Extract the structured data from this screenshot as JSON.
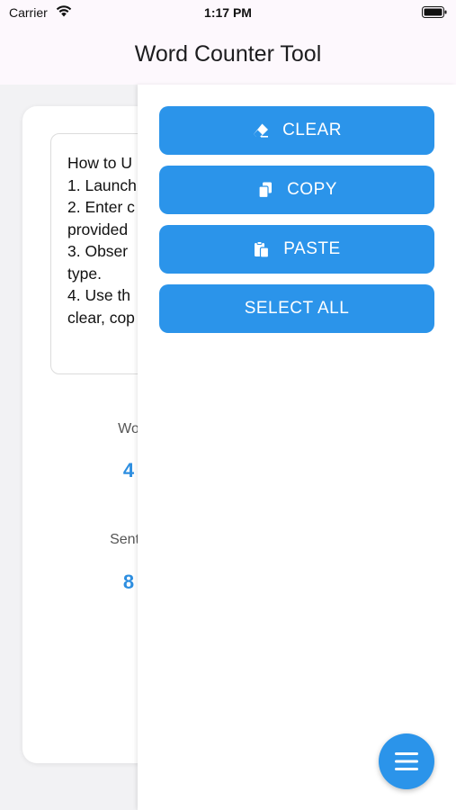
{
  "status_bar": {
    "carrier": "Carrier",
    "time": "1:17 PM"
  },
  "nav": {
    "title": "Word Counter Tool"
  },
  "editor": {
    "text": "How to U\n1. Launch\n2. Enter c\nprovided\n3. Obser\ntype.\n4. Use th\nclear, cop"
  },
  "stats": {
    "words_label": "Wo",
    "words_value": "4",
    "sentences_label": "Sente",
    "sentences_value": "8"
  },
  "drawer": {
    "buttons": [
      {
        "label": "CLEAR",
        "icon": "eraser-icon"
      },
      {
        "label": "COPY",
        "icon": "copy-icon"
      },
      {
        "label": "PASTE",
        "icon": "paste-icon"
      },
      {
        "label": "SELECT ALL",
        "icon": ""
      }
    ]
  },
  "fab": {
    "icon": "menu-icon"
  },
  "colors": {
    "accent": "#2b94ea",
    "stat_value": "#2d8ee0",
    "header_bg": "#fdf8fd",
    "page_bg": "#f2f2f4"
  }
}
